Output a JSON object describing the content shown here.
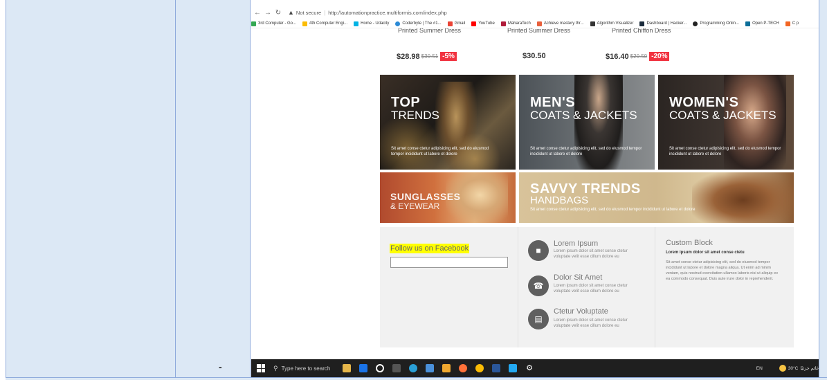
{
  "browser": {
    "security_label": "Not secure",
    "url": "http://automationpractice.multiformis.com/index.php",
    "bookmarks": [
      "3rd Computer - Go...",
      "4th Computer Engi...",
      "Home - Udacity",
      "Coderbyte | The #1...",
      "Gmail",
      "YouTube",
      "MaharaTech",
      "Achieve mastery thr...",
      "Algorithm Visualizer",
      "Dashboard | Hacker...",
      "Programming Onlin...",
      "Open P-TECH",
      "C p"
    ]
  },
  "products": [
    {
      "name": "Printed Summer Dress",
      "price": "$28.98",
      "old_price": "$30.51",
      "discount": "-5%"
    },
    {
      "name": "Printed Summer Dress",
      "price": "$30.50",
      "old_price": "",
      "discount": ""
    },
    {
      "name": "Printed Chiffon Dress",
      "price": "$16.40",
      "old_price": "$20.50",
      "discount": "-20%"
    }
  ],
  "banners": {
    "top_trends": {
      "title": "TOP",
      "subtitle": "TRENDS",
      "text": "Sit amet conse ctetur adipisicing elit, sed do eiusmod tempor incididunt ut labore et dolore"
    },
    "mens": {
      "title": "MEN'S",
      "subtitle": "COATS & JACKETS",
      "text": "Sit amet conse ctetur adipisicing elit, sed do eiusmod tempor incididunt ut labore et dolore"
    },
    "womens": {
      "title": "WOMEN'S",
      "subtitle": "COATS & JACKETS",
      "text": "Sit amet conse ctetur adipisicing elit, sed do eiusmod tempor incididunt ut labore et dolore"
    },
    "sunglasses": {
      "title": "SUNGLASSES",
      "subtitle": "& EYEWEAR"
    },
    "savvy": {
      "title": "SAVVY TRENDS",
      "subtitle": "HANDBAGS",
      "text": "Sit amet conse ctetur adipisicing elit, sed do eiusmod tempor incididunt ut labore et dolore"
    }
  },
  "footer": {
    "facebook_title": "Follow us on Facebook",
    "features": [
      {
        "title": "Lorem Ipsum",
        "text": "Lorem ipsum dolor sit amet conse ctetur voluptate velit esse cillum dolore eu",
        "icon": "truck-icon"
      },
      {
        "title": "Dolor Sit Amet",
        "text": "Lorem ipsum dolor sit amet conse ctetur voluptate velit esse cillum dolore eu",
        "icon": "phone-icon"
      },
      {
        "title": "Ctetur Voluptate",
        "text": "Lorem ipsum dolor sit amet conse ctetur voluptate velit esse cillum dolore eu",
        "icon": "card-icon"
      }
    ],
    "custom_block": {
      "title": "Custom Block",
      "strong": "Lorem ipsum dolor sit amet conse ctetu",
      "text": "Sit amet conse ctetur adipisicing elit, sed do eiusmod tempor incididunt ut labore et dolore magna aliqua. Ut enim ad minim veniam, quis nostrud exercitation ullamco laboris nisi ut aliquip ex ea commodo consequat. Duis aute irure dolor in reprehenderit."
    }
  },
  "taskbar": {
    "search_placeholder": "Type here to search",
    "lang": "EN",
    "weather": "30°C",
    "weather_extra": "غائم جزئيًا"
  },
  "document": {
    "dash": "-"
  },
  "colors": {
    "discount": "#f13340",
    "highlight": "#ffff00",
    "table_fill": "#dce8f5",
    "taskbar": "#1f1f1f"
  }
}
